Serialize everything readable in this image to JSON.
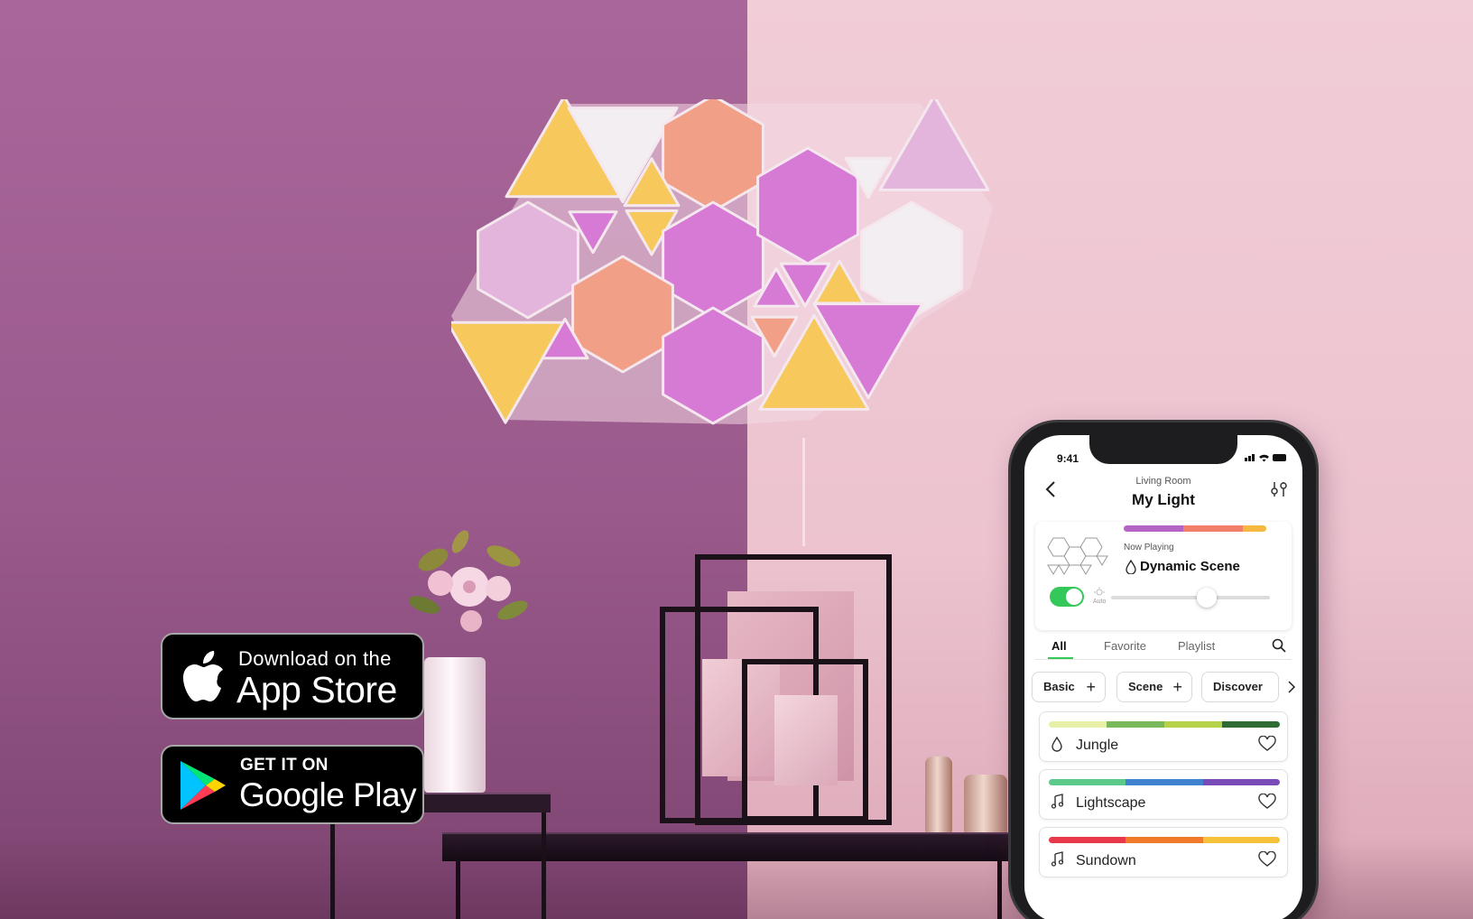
{
  "colors": {
    "wall_left": "#a9669a",
    "wall_right": "#f1cdd7",
    "panel_yellow": "#f7c95d",
    "panel_pink": "#d77ad5",
    "panel_orange": "#f19f86",
    "panel_white": "#f3eef1",
    "panel_lilac": "#e3b4dc",
    "toggle_green": "#34c759"
  },
  "badges": {
    "app_store": {
      "small": "Download on the",
      "big": "App Store",
      "icon": "apple-icon"
    },
    "google_play": {
      "small": "GET IT ON",
      "big": "Google Play",
      "icon": "google-play-icon"
    }
  },
  "phone": {
    "status": {
      "time": "9:41"
    },
    "header": {
      "room": "Living Room",
      "title": "My Light"
    },
    "now_playing": {
      "label": "Now Playing",
      "scene": "Dynamic Scene",
      "auto_label": "Auto",
      "brightness": 0.6
    },
    "tabs": [
      "All",
      "Favorite",
      "Playlist"
    ],
    "active_tab": "All",
    "filters": [
      "Basic",
      "Scene",
      "Discover"
    ],
    "scenes": [
      {
        "name": "Jungle",
        "icon": "drop-icon",
        "colors": [
          "#e8f0a8",
          "#7ab85c",
          "#b5d24a",
          "#2f6b34"
        ]
      },
      {
        "name": "Lightscape",
        "icon": "music-note-icon",
        "colors": [
          "#5cc98a",
          "#3f82cf",
          "#7a4ab8"
        ]
      },
      {
        "name": "Sundown",
        "icon": "music-note-icon",
        "colors": [
          "#e8384a",
          "#f07a2a",
          "#f6c23a"
        ]
      }
    ],
    "now_playing_bar": [
      "#b664c4",
      "#f17f6a",
      "#f6b840"
    ]
  }
}
